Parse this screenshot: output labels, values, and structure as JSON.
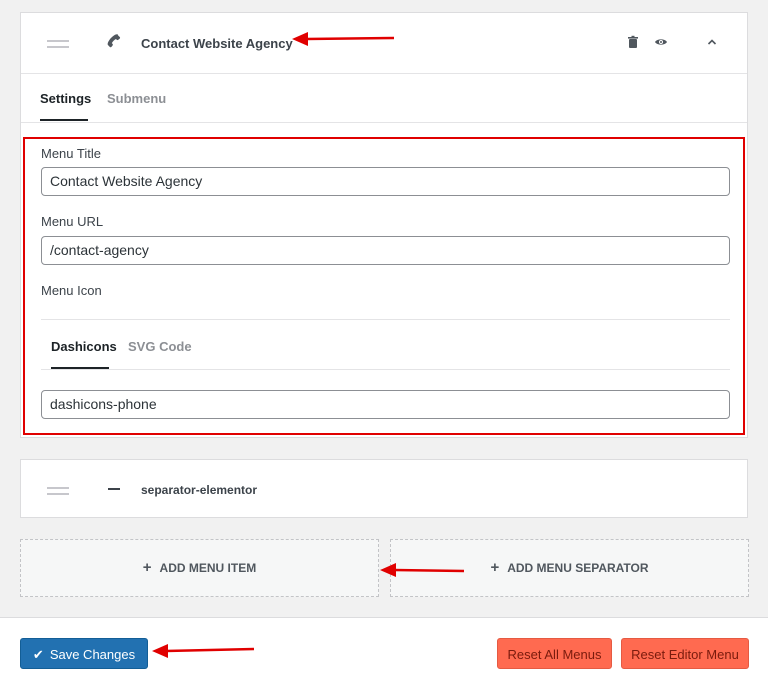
{
  "menu_item": {
    "title": "Contact Website Agency",
    "icon": "phone-icon",
    "actions": [
      "trash-icon",
      "eye-icon",
      "chevron-up-icon"
    ],
    "tabs": [
      {
        "label": "Settings",
        "active": true
      },
      {
        "label": "Submenu",
        "active": false
      }
    ],
    "fields": {
      "menu_title_label": "Menu Title",
      "menu_title_value": "Contact Website Agency",
      "menu_url_label": "Menu URL",
      "menu_url_value": "/contact-agency",
      "menu_icon_label": "Menu Icon",
      "icon_tabs": [
        {
          "label": "Dashicons",
          "active": true
        },
        {
          "label": "SVG Code",
          "active": false
        }
      ],
      "icon_value": "dashicons-phone"
    }
  },
  "separator_item": {
    "title": "separator-elementor",
    "icon": "minus-icon"
  },
  "add_buttons": {
    "add_item": "ADD MENU ITEM",
    "add_separator": "ADD MENU SEPARATOR"
  },
  "footer": {
    "save": "Save Changes",
    "reset_all": "Reset All Menus",
    "reset_editor": "Reset Editor Menu"
  },
  "colors": {
    "primary": "#2271b1",
    "danger": "#ff6a50",
    "highlight": "#e00000"
  }
}
